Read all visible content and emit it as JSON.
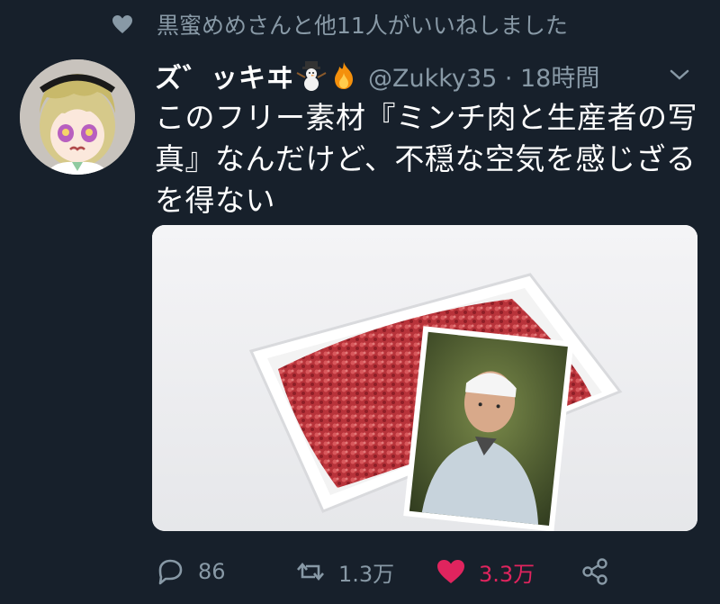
{
  "social_context": {
    "text": "黒蜜めめさんと他11人がいいねしました",
    "icon": "heart-icon"
  },
  "tweet": {
    "display_name": "ズ゛ッキヰ",
    "handle_time": "@Zukky35 · 18時間",
    "text": "このフリー素材『ミンチ肉と生産者の写真』なんだけど、不穏な空気を感じざるを得ない",
    "name_emojis": [
      "snowman-icon",
      "fire-icon"
    ]
  },
  "actions": {
    "reply_count": "86",
    "retweet_count": "1.3万",
    "like_count": "3.3万",
    "liked": true
  },
  "colors": {
    "background": "#17202b",
    "muted": "#8899a6",
    "like": "#e0245e",
    "text": "#ffffff"
  }
}
